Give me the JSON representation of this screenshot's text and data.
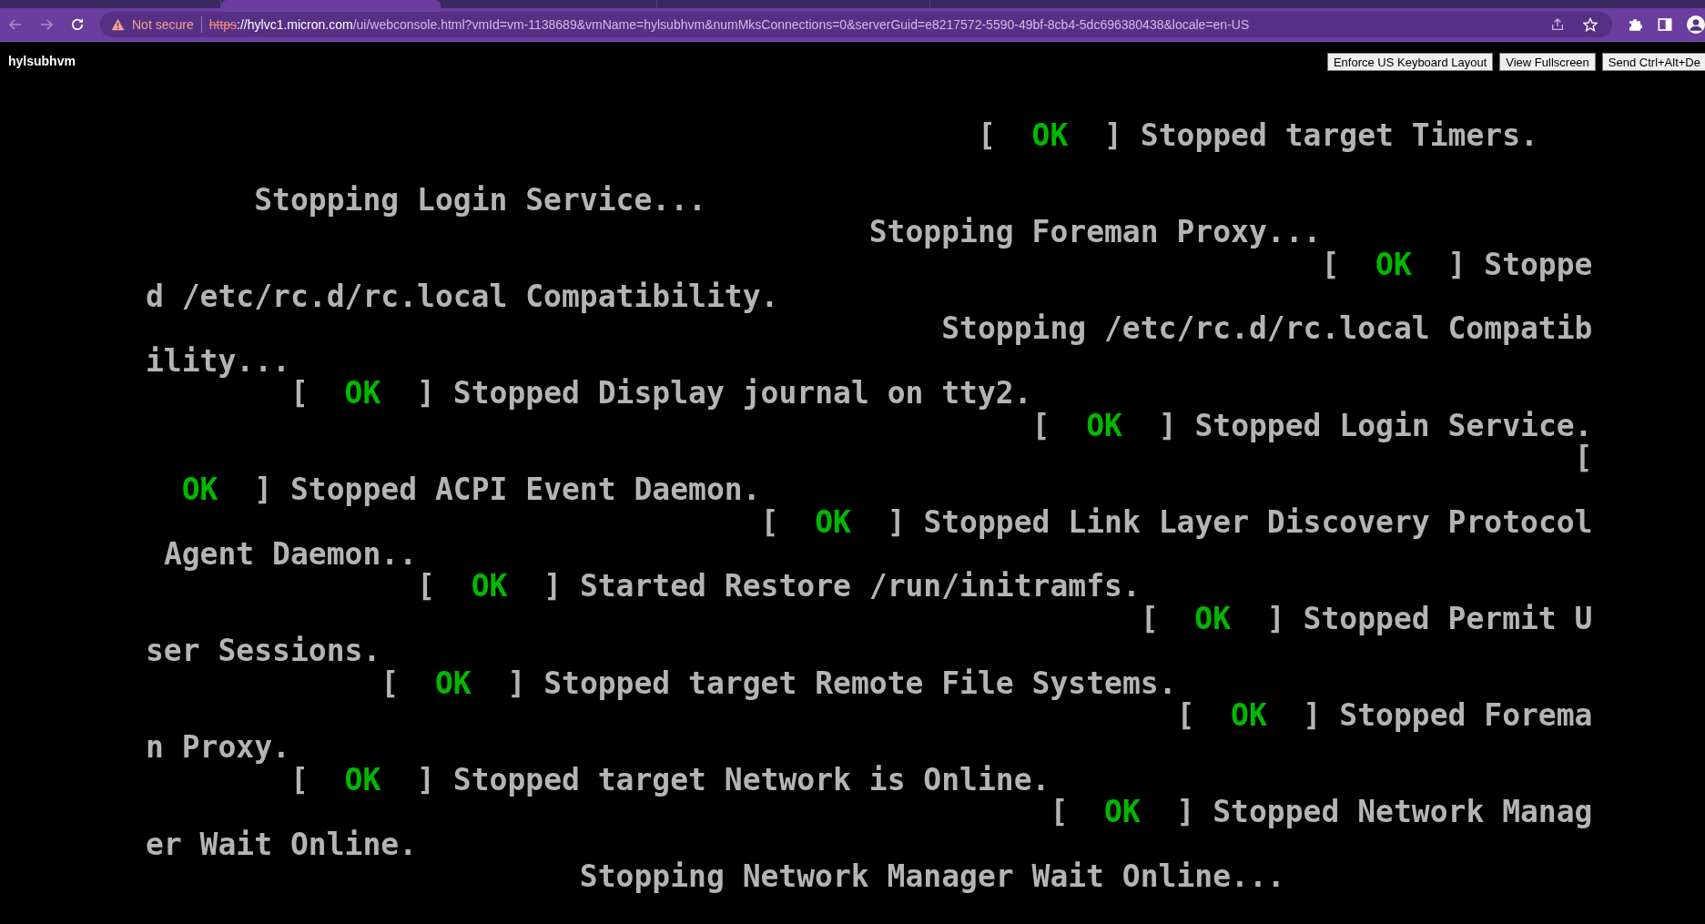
{
  "browser": {
    "tabs": [
      {
        "selected": false
      },
      {
        "selected": true
      },
      {
        "selected": false
      },
      {
        "selected": false
      }
    ],
    "address_bar": {
      "security_label": "Not secure",
      "url": [
        {
          "kind": "scheme",
          "text": "https"
        },
        {
          "kind": "plain",
          "text": "://"
        },
        {
          "kind": "host",
          "text": "hylvc1.micron.com"
        },
        {
          "kind": "path",
          "text": "/ui/webconsole.html?vmId=vm-1138689&vmName=hylsubhvm&numMksConnections=0&serverGuid=e8217572-5590-49bf-8cb4-5dc696380438&locale=en-US"
        }
      ]
    }
  },
  "console_header": {
    "vm_name": "hylsubhvm",
    "buttons": [
      "Enforce US Keyboard Layout",
      "View Fullscreen",
      "Send Ctrl+Alt+De"
    ]
  },
  "console": {
    "lines": [
      {
        "segments": [
          {
            "kind": "text",
            "text": "                                              [  "
          },
          {
            "kind": "ok",
            "text": "OK"
          },
          {
            "kind": "text",
            "text": "  ] Stopped target Timers."
          }
        ]
      },
      {
        "blank_line_before": true,
        "segments": [
          {
            "kind": "text",
            "text": "      Stopping Login Service..."
          }
        ]
      },
      {
        "segments": [
          {
            "kind": "text",
            "text": "                                        Stopping Foreman Proxy..."
          }
        ]
      },
      {
        "segments": [
          {
            "kind": "text",
            "text": "                                                                 [  "
          },
          {
            "kind": "ok",
            "text": "OK"
          },
          {
            "kind": "text",
            "text": "  ] Stoppe"
          }
        ]
      },
      {
        "segments": [
          {
            "kind": "text",
            "text": "d /etc/rc.d/rc.local Compatibility."
          }
        ]
      },
      {
        "segments": [
          {
            "kind": "text",
            "text": "                                            Stopping /etc/rc.d/rc.local Compatib"
          }
        ]
      },
      {
        "segments": [
          {
            "kind": "text",
            "text": "ility..."
          }
        ]
      },
      {
        "segments": [
          {
            "kind": "text",
            "text": "        [  "
          },
          {
            "kind": "ok",
            "text": "OK"
          },
          {
            "kind": "text",
            "text": "  ] Stopped Display journal on tty2."
          }
        ]
      },
      {
        "segments": [
          {
            "kind": "text",
            "text": "                                                 [  "
          },
          {
            "kind": "ok",
            "text": "OK"
          },
          {
            "kind": "text",
            "text": "  ] Stopped Login Service."
          }
        ]
      },
      {
        "segments": [
          {
            "kind": "text",
            "text": "                                                                               ["
          }
        ]
      },
      {
        "segments": [
          {
            "kind": "ok",
            "text": "  OK"
          },
          {
            "kind": "text",
            "text": "  ] Stopped ACPI Event Daemon."
          }
        ]
      },
      {
        "segments": [
          {
            "kind": "text",
            "text": "                                  [  "
          },
          {
            "kind": "ok",
            "text": "OK"
          },
          {
            "kind": "text",
            "text": "  ] Stopped Link Layer Discovery Protocol"
          }
        ]
      },
      {
        "segments": [
          {
            "kind": "text",
            "text": " Agent Daemon.."
          }
        ]
      },
      {
        "segments": [
          {
            "kind": "text",
            "text": "               [  "
          },
          {
            "kind": "ok",
            "text": "OK"
          },
          {
            "kind": "text",
            "text": "  ] Started Restore /run/initramfs."
          }
        ]
      },
      {
        "segments": [
          {
            "kind": "text",
            "text": "                                                       [  "
          },
          {
            "kind": "ok",
            "text": "OK"
          },
          {
            "kind": "text",
            "text": "  ] Stopped Permit U"
          }
        ]
      },
      {
        "segments": [
          {
            "kind": "text",
            "text": "ser Sessions."
          }
        ]
      },
      {
        "segments": [
          {
            "kind": "text",
            "text": "             [  "
          },
          {
            "kind": "ok",
            "text": "OK"
          },
          {
            "kind": "text",
            "text": "  ] Stopped target Remote File Systems."
          }
        ]
      },
      {
        "segments": [
          {
            "kind": "text",
            "text": "                                                         [  "
          },
          {
            "kind": "ok",
            "text": "OK"
          },
          {
            "kind": "text",
            "text": "  ] Stopped Forema"
          }
        ]
      },
      {
        "segments": [
          {
            "kind": "text",
            "text": "n Proxy."
          }
        ]
      },
      {
        "segments": [
          {
            "kind": "text",
            "text": "        [  "
          },
          {
            "kind": "ok",
            "text": "OK"
          },
          {
            "kind": "text",
            "text": "  ] Stopped target Network is Online."
          }
        ]
      },
      {
        "segments": [
          {
            "kind": "text",
            "text": "                                                  [  "
          },
          {
            "kind": "ok",
            "text": "OK"
          },
          {
            "kind": "text",
            "text": "  ] Stopped Network Manag"
          }
        ]
      },
      {
        "segments": [
          {
            "kind": "text",
            "text": "er Wait Online."
          }
        ]
      },
      {
        "segments": [
          {
            "kind": "text",
            "text": "                        Stopping Network Manager Wait Online..."
          }
        ]
      }
    ]
  }
}
